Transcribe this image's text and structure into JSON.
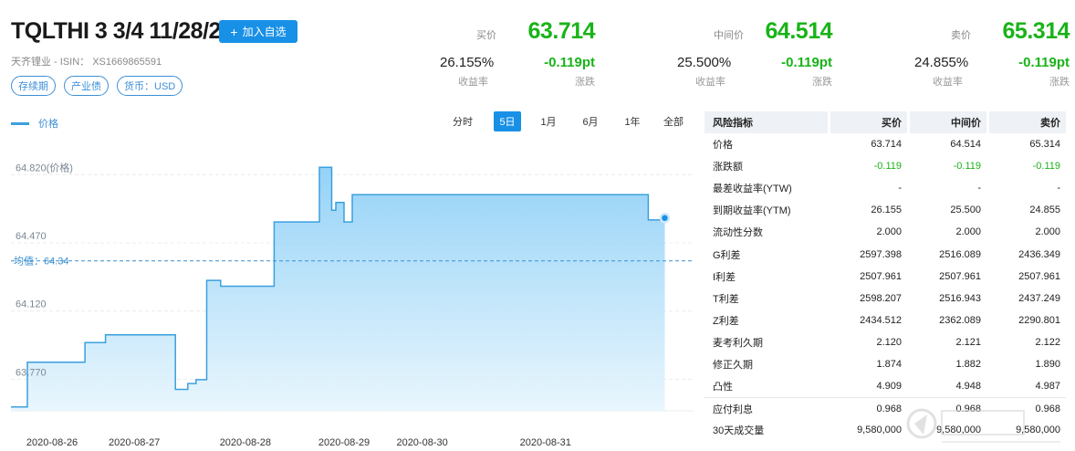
{
  "header": {
    "title": "TQLTHI 3 3/4 11/28/22",
    "add_button": "加入自选",
    "issuer_line": "天齐锂业 - ISIN： XS1669865591",
    "tags": [
      "存续期",
      "产业债",
      "货币：USD"
    ]
  },
  "quotes": [
    {
      "label": "买价",
      "price": "63.714",
      "yield": "26.155%",
      "yield_label": "收益率",
      "change": "-0.119pt",
      "change_label": "涨跌"
    },
    {
      "label": "中间价",
      "price": "64.514",
      "yield": "25.500%",
      "yield_label": "收益率",
      "change": "-0.119pt",
      "change_label": "涨跌"
    },
    {
      "label": "卖价",
      "price": "65.314",
      "yield": "24.855%",
      "yield_label": "收益率",
      "change": "-0.119pt",
      "change_label": "涨跌"
    }
  ],
  "chart_controls": {
    "legend_label": "价格",
    "ranges": [
      "分时",
      "5日",
      "1月",
      "6月",
      "1年",
      "全部"
    ],
    "active_range": "5日"
  },
  "chart_data": {
    "type": "area",
    "series": [
      {
        "name": "价格",
        "color": "#3aa0de"
      }
    ],
    "y_ticks": [
      "64.820(价格)",
      "64.470",
      "64.120",
      "63.770"
    ],
    "y_tick_values": [
      64.82,
      64.47,
      64.12,
      63.77
    ],
    "ylim": [
      63.57,
      64.92
    ],
    "mean_label": "均值：64.34",
    "mean_value": 64.34,
    "x_labels": [
      "2020-08-26",
      "2020-08-27",
      "2020-08-28",
      "2020-08-29",
      "2020-08-30",
      "2020-08-31"
    ],
    "x_label_positions": [
      0.5,
      1.5,
      2.85,
      4.05,
      5.0,
      6.5
    ],
    "xlim": [
      0.0,
      8.3
    ],
    "points": [
      [
        0.0,
        63.59
      ],
      [
        0.2,
        63.59
      ],
      [
        0.2,
        63.82
      ],
      [
        0.9,
        63.82
      ],
      [
        0.9,
        63.92
      ],
      [
        1.15,
        63.92
      ],
      [
        1.15,
        63.96
      ],
      [
        2.0,
        63.96
      ],
      [
        2.0,
        63.68
      ],
      [
        2.15,
        63.68
      ],
      [
        2.15,
        63.71
      ],
      [
        2.25,
        63.71
      ],
      [
        2.25,
        63.73
      ],
      [
        2.38,
        63.73
      ],
      [
        2.38,
        64.24
      ],
      [
        2.55,
        64.24
      ],
      [
        2.55,
        64.21
      ],
      [
        3.2,
        64.21
      ],
      [
        3.2,
        64.54
      ],
      [
        3.75,
        64.54
      ],
      [
        3.75,
        64.82
      ],
      [
        3.9,
        64.82
      ],
      [
        3.9,
        64.6
      ],
      [
        3.95,
        64.6
      ],
      [
        3.95,
        64.64
      ],
      [
        4.05,
        64.64
      ],
      [
        4.05,
        64.54
      ],
      [
        4.15,
        64.54
      ],
      [
        4.15,
        64.68
      ],
      [
        7.75,
        64.68
      ],
      [
        7.75,
        64.55
      ],
      [
        7.95,
        64.55
      ],
      [
        7.95,
        64.56
      ]
    ],
    "last_point": [
      7.95,
      64.56
    ]
  },
  "risk_table": {
    "columns": [
      "风险指标",
      "买价",
      "中间价",
      "卖价"
    ],
    "rows": [
      {
        "name": "价格",
        "values": [
          "63.714",
          "64.514",
          "65.314"
        ]
      },
      {
        "name": "涨跌额",
        "values": [
          "-0.119",
          "-0.119",
          "-0.119"
        ],
        "color": "#19b319"
      },
      {
        "name": "最差收益率(YTW)",
        "values": [
          "-",
          "-",
          "-"
        ]
      },
      {
        "name": "到期收益率(YTM)",
        "values": [
          "26.155",
          "25.500",
          "24.855"
        ]
      },
      {
        "name": "流动性分数",
        "values": [
          "2.000",
          "2.000",
          "2.000"
        ]
      },
      {
        "name": "G利差",
        "values": [
          "2597.398",
          "2516.089",
          "2436.349"
        ]
      },
      {
        "name": "I利差",
        "values": [
          "2507.961",
          "2507.961",
          "2507.961"
        ]
      },
      {
        "name": "T利差",
        "values": [
          "2598.207",
          "2516.943",
          "2437.249"
        ]
      },
      {
        "name": "Z利差",
        "values": [
          "2434.512",
          "2362.089",
          "2290.801"
        ]
      },
      {
        "name": "麦考利久期",
        "values": [
          "2.120",
          "2.121",
          "2.122"
        ]
      },
      {
        "name": "修正久期",
        "values": [
          "1.874",
          "1.882",
          "1.890"
        ]
      },
      {
        "name": "凸性",
        "values": [
          "4.909",
          "4.948",
          "4.987"
        ]
      },
      {
        "name": "应付利息",
        "values": [
          "0.968",
          "0.968",
          "0.968"
        ]
      },
      {
        "name": "30天成交量",
        "values": [
          "9,580,000",
          "9,580,000",
          "9,580,000"
        ]
      }
    ]
  },
  "colors": {
    "accent": "#1890e6",
    "up_down_green": "#19b319",
    "series_line": "#3aa0de"
  }
}
